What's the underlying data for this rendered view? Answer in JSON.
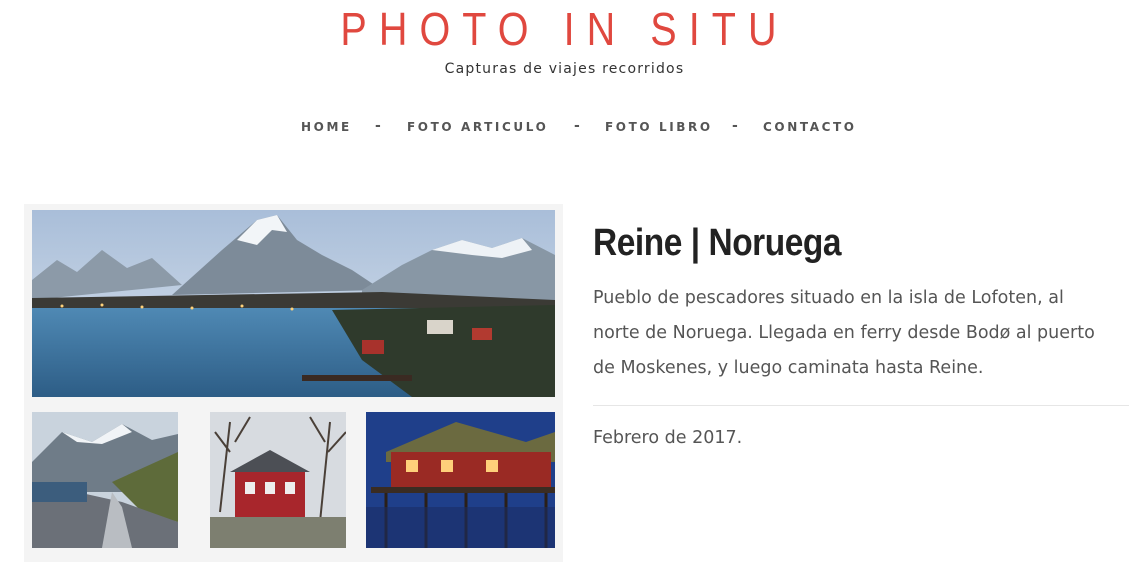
{
  "header": {
    "title": "PHOTO IN SITU",
    "tagline": "Capturas de viajes recorridos"
  },
  "nav": {
    "items": [
      {
        "label": "HOME"
      },
      {
        "label": "FOTO ARTICULO"
      },
      {
        "label": "FOTO LIBRO"
      },
      {
        "label": "CONTACTO"
      }
    ],
    "separator": "-"
  },
  "post": {
    "title": "Reine | Noruega",
    "description": "Pueblo de pescadores situado en la isla de Lofoten, al norte de Noruega. Llegada en ferry desde Bodø al puerto de Moskenes, y luego caminata hasta Reine.",
    "date": "Febrero de 2017."
  },
  "colors": {
    "title_red": "#e0483f",
    "text_dark": "#222222",
    "text_gray": "#555555",
    "divider": "#e6e6e6"
  }
}
